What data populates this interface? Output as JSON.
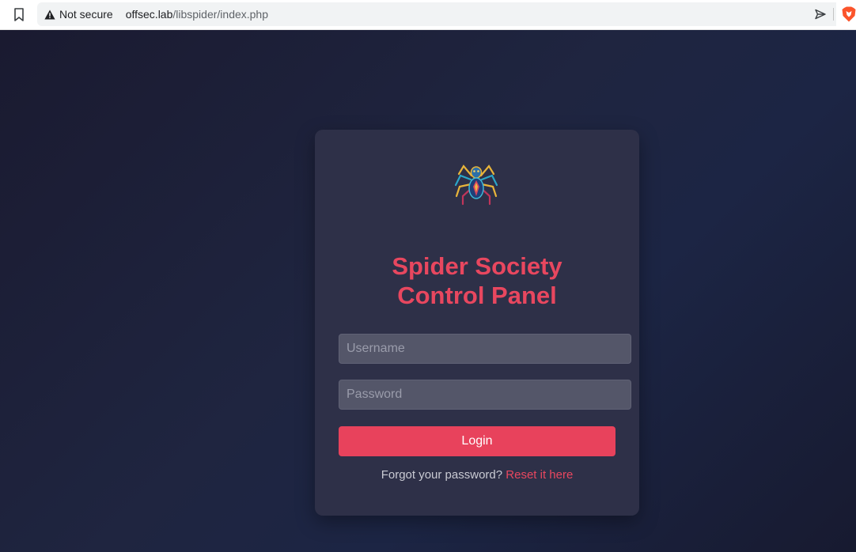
{
  "browser": {
    "security_label": "Not secure",
    "url_host": "offsec.lab",
    "url_path": "/libspider/index.php",
    "icons": [
      "bookmark-icon",
      "warning-icon",
      "share-icon",
      "brave-lion-icon"
    ]
  },
  "login": {
    "logo_icon": "spider-logo-icon",
    "title_line1": "Spider Society",
    "title_line2": "Control Panel",
    "username_placeholder": "Username",
    "password_placeholder": "Password",
    "login_label": "Login",
    "forgot_text": "Forgot your password?",
    "reset_link": "Reset it here"
  },
  "colors": {
    "accent": "#e8475f",
    "card_bg": "#2e3048",
    "page_bg": "#1c1d33",
    "input_bg": "#545669"
  }
}
